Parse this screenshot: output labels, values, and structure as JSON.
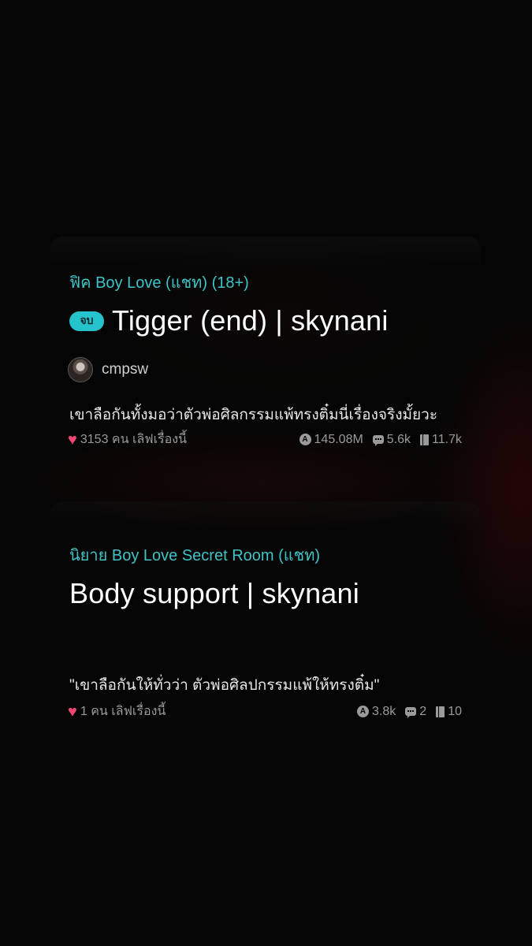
{
  "stories": [
    {
      "category": "ฟิค Boy Love (แชท) (18+)",
      "badge": "จบ",
      "title": "Tigger (end) | skynani",
      "author": "cmpsw",
      "description": "เขาลือกันทั้งมอว่าตัวพ่อศิลกรรมแพ้ทรงติ๋มนี่เรื่องจริงมั้ยวะ",
      "likes_text": "3153 คน เลิฟเรื่องนี้",
      "views": "145.08M",
      "comments": "5.6k",
      "chapters": "11.7k"
    },
    {
      "category": "นิยาย Boy Love Secret Room (แชท)",
      "title": "Body support | skynani",
      "description": "\"เขาลือกันให้ทั่วว่า ตัวพ่อศิลปกรรมแพ้ให้ทรงติ๋ม\"",
      "likes_text": "1 คน เลิฟเรื่องนี้",
      "views": "3.8k",
      "comments": "2",
      "chapters": "10"
    }
  ],
  "icons": {
    "view": "A",
    "heart": "♥"
  },
  "colors": {
    "accent": "#3fc3c8",
    "badge_bg": "#26c3cc",
    "heart": "#f0466f",
    "muted": "#9a9a9a"
  }
}
